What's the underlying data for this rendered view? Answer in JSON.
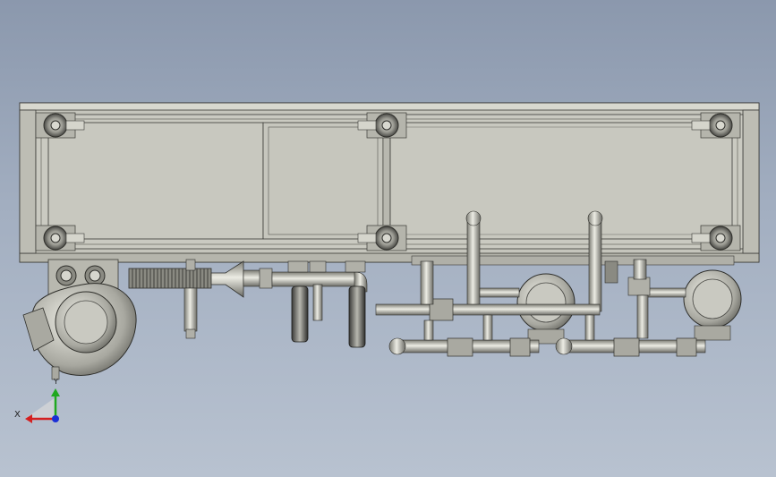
{
  "viewport": {
    "background_top": "#8b98ad",
    "background_bottom": "#b8c2d0"
  },
  "model": {
    "part_color": "#c9c9c0",
    "shadow_color": "#7d7d75",
    "edge_color": "#3a3a36"
  },
  "triad": {
    "x_label": "X",
    "y_label": "Y",
    "x_color": "#d42020",
    "y_color": "#1fa81f",
    "z_color": "#1b2fd6"
  }
}
